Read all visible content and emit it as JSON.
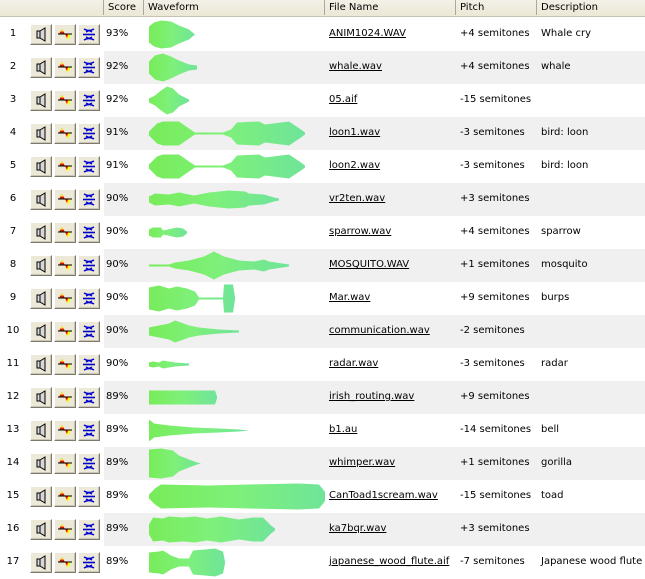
{
  "columns": {
    "index": "",
    "actions": "",
    "score": "Score",
    "waveform": "Waveform",
    "file_name": "File Name",
    "pitch": "Pitch",
    "description": "Description"
  },
  "icons": {
    "play": "speaker-icon",
    "pitch": "waveform-color-icon",
    "similar": "compress-arrows-icon"
  },
  "colors": {
    "header_bg": "#ece9d8",
    "row_alt": "#f0f0f0",
    "waveform_green": "#7ef07a",
    "waveform_cyan": "#5fd8c8",
    "button_bg": "#ece9d8",
    "icon_blue": "#0000cc"
  },
  "rows": [
    {
      "index": "1",
      "score": "93%",
      "file_name": "ANIM1024.WAV",
      "pitch": "+4 semitones",
      "description": "Whale cry"
    },
    {
      "index": "2",
      "score": "92%",
      "file_name": "whale.wav",
      "pitch": "+4 semitones",
      "description": "whale"
    },
    {
      "index": "3",
      "score": "92%",
      "file_name": "05.aif",
      "pitch": "-15 semitones",
      "description": ""
    },
    {
      "index": "4",
      "score": "91%",
      "file_name": "loon1.wav",
      "pitch": "-3 semitones",
      "description": "bird: loon"
    },
    {
      "index": "5",
      "score": "91%",
      "file_name": "loon2.wav",
      "pitch": "-3 semitones",
      "description": "bird: loon"
    },
    {
      "index": "6",
      "score": "90%",
      "file_name": "vr2ten.wav",
      "pitch": "+3 semitones",
      "description": ""
    },
    {
      "index": "7",
      "score": "90%",
      "file_name": "sparrow.wav",
      "pitch": "+4 semitones",
      "description": "sparrow"
    },
    {
      "index": "8",
      "score": "90%",
      "file_name": "MOSQUITO.WAV",
      "pitch": "+1 semitones",
      "description": "mosquito"
    },
    {
      "index": "9",
      "score": "90%",
      "file_name": "Mar.wav",
      "pitch": "+9 semitones",
      "description": "burps"
    },
    {
      "index": "10",
      "score": "90%",
      "file_name": "communication.wav",
      "pitch": "-2 semitones",
      "description": ""
    },
    {
      "index": "11",
      "score": "90%",
      "file_name": "radar.wav",
      "pitch": "-3 semitones",
      "description": "radar"
    },
    {
      "index": "12",
      "score": "89%",
      "file_name": "irish_routing.wav",
      "pitch": "+9 semitones",
      "description": ""
    },
    {
      "index": "13",
      "score": "89%",
      "file_name": "b1.au",
      "pitch": "-14 semitones",
      "description": "bell"
    },
    {
      "index": "14",
      "score": "89%",
      "file_name": "whimper.wav",
      "pitch": "+1 semitones",
      "description": "gorilla"
    },
    {
      "index": "15",
      "score": "89%",
      "file_name": "CanToad1scream.wav",
      "pitch": "-15 semitones",
      "description": "toad"
    },
    {
      "index": "16",
      "score": "89%",
      "file_name": "ka7bqr.wav",
      "pitch": "+3 semitones",
      "description": ""
    },
    {
      "index": "17",
      "score": "89%",
      "file_name": "japanese_wood_flute.aif",
      "pitch": "-7 semitones",
      "description": "Japanese wood flute"
    }
  ]
}
